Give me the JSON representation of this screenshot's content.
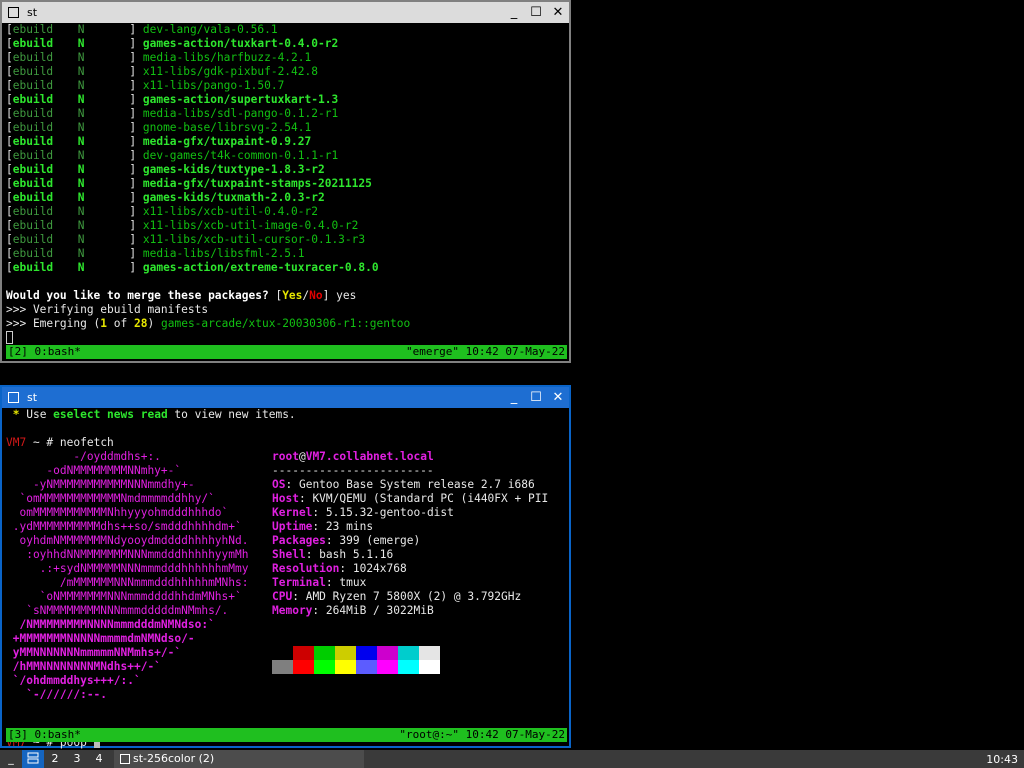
{
  "window1": {
    "title": "st",
    "packages": [
      {
        "tag": "ebuild",
        "flag": "N",
        "name": "dev-lang/vala-0.56.1",
        "bold": false
      },
      {
        "tag": "ebuild",
        "flag": "N",
        "name": "games-action/tuxkart-0.4.0-r2",
        "bold": true
      },
      {
        "tag": "ebuild",
        "flag": "N",
        "name": "media-libs/harfbuzz-4.2.1",
        "bold": false
      },
      {
        "tag": "ebuild",
        "flag": "N",
        "name": "x11-libs/gdk-pixbuf-2.42.8",
        "bold": false
      },
      {
        "tag": "ebuild",
        "flag": "N",
        "name": "x11-libs/pango-1.50.7",
        "bold": false
      },
      {
        "tag": "ebuild",
        "flag": "N",
        "name": "games-action/supertuxkart-1.3",
        "bold": true
      },
      {
        "tag": "ebuild",
        "flag": "N",
        "name": "media-libs/sdl-pango-0.1.2-r1",
        "bold": false
      },
      {
        "tag": "ebuild",
        "flag": "N",
        "name": "gnome-base/librsvg-2.54.1",
        "bold": false
      },
      {
        "tag": "ebuild",
        "flag": "N",
        "name": "media-gfx/tuxpaint-0.9.27",
        "bold": true
      },
      {
        "tag": "ebuild",
        "flag": "N",
        "name": "dev-games/t4k-common-0.1.1-r1",
        "bold": false
      },
      {
        "tag": "ebuild",
        "flag": "N",
        "name": "games-kids/tuxtype-1.8.3-r2",
        "bold": true
      },
      {
        "tag": "ebuild",
        "flag": "N",
        "name": "media-gfx/tuxpaint-stamps-20211125",
        "bold": true
      },
      {
        "tag": "ebuild",
        "flag": "N",
        "name": "games-kids/tuxmath-2.0.3-r2",
        "bold": true
      },
      {
        "tag": "ebuild",
        "flag": "N",
        "name": "x11-libs/xcb-util-0.4.0-r2",
        "bold": false
      },
      {
        "tag": "ebuild",
        "flag": "N",
        "name": "x11-libs/xcb-util-image-0.4.0-r2",
        "bold": false
      },
      {
        "tag": "ebuild",
        "flag": "N",
        "name": "x11-libs/xcb-util-cursor-0.1.3-r3",
        "bold": false
      },
      {
        "tag": "ebuild",
        "flag": "N",
        "name": "media-libs/libsfml-2.5.1",
        "bold": false
      },
      {
        "tag": "ebuild",
        "flag": "N",
        "name": "games-action/extreme-tuxracer-0.8.0",
        "bold": true
      }
    ],
    "merge_question": "Would you like to merge these packages?",
    "yes": "Yes",
    "no": "No",
    "answer": "yes",
    "verifying": ">>> Verifying ebuild manifests",
    "emerging_prefix": ">>> Emerging (",
    "emerging_n": "1",
    "emerging_of": "of",
    "emerging_total": "28",
    "emerging_pkg": "games-arcade/xtux-20030306-r1::gentoo",
    "status_left": "[2] 0:bash*",
    "status_right": "\"emerge\" 10:42 07-May-22"
  },
  "window2": {
    "title": "st",
    "news_pre": " * Use ",
    "news_cmd": "eselect news read",
    "news_post": " to view new items.",
    "prompt_host": "VM7",
    "prompt_sep": " ~ # ",
    "cmd1": "neofetch",
    "cmd2": "poop",
    "logo": [
      "          -/oyddmdhs+:.",
      "      -odNMMMMMMMMNNmhy+-`",
      "    -yNMMMMMMMMMMMNNNmmdhy+-",
      "  `omMMMMMMMMMMMMNmdmmmmddhhy/`",
      "  omMMMMMMMMMMMNhhyyyohmdddhhhdo`",
      " .ydMMMMMMMMMMdhs++so/smdddhhhhdm+`",
      "  oyhdmNMMMMMMMNdyooydmddddhhhhyhNd.",
      "   :oyhhdNNMMMMMMMNNNmmdddhhhhhyymMh",
      "     .:+sydNMMMMMNNNmmmdddhhhhhhmMmy",
      "        /mMMMMMMNNNmmmdddhhhhhmMNhs:",
      "     `oNMMMMMMMNNNmmmddddhhdmMNhs+`",
      "   `sNMMMMMMMMNNNmmmdddddmNMmhs/.",
      "  /NMMMMMMMMNNNNmmmdddmNMNdso:`",
      " +MMMMMMMNNNNNmmmmdmNMNdso/-",
      " yMMNNNNNNNmmmmmNNMmhs+/-`",
      " /hMMNNNNNNNNMNdhs++/-`",
      " `/ohdmmddhys+++/:.`",
      "   `-//////:--."
    ],
    "user": "root",
    "host": "VM7.collabnet.local",
    "separator": "------------------------",
    "info": [
      {
        "key": "OS",
        "value": "Gentoo Base System release 2.7 i686"
      },
      {
        "key": "Host",
        "value": "KVM/QEMU (Standard PC (i440FX + PII"
      },
      {
        "key": "Kernel",
        "value": "5.15.32-gentoo-dist"
      },
      {
        "key": "Uptime",
        "value": "23 mins"
      },
      {
        "key": "Packages",
        "value": "399 (emerge)"
      },
      {
        "key": "Shell",
        "value": "bash 5.1.16"
      },
      {
        "key": "Resolution",
        "value": "1024x768"
      },
      {
        "key": "Terminal",
        "value": "tmux"
      },
      {
        "key": "CPU",
        "value": "AMD Ryzen 7 5800X (2) @ 3.792GHz"
      },
      {
        "key": "Memory",
        "value": "264MiB / 3022MiB"
      }
    ],
    "palette_top": [
      "#000000",
      "#cd0000",
      "#00cd00",
      "#cdcd00",
      "#0000ee",
      "#cd00cd",
      "#00cdcd",
      "#e5e5e5"
    ],
    "palette_bottom": [
      "#7f7f7f",
      "#ff0000",
      "#00ff00",
      "#ffff00",
      "#5c5cff",
      "#ff00ff",
      "#00ffff",
      "#ffffff"
    ],
    "status_left": "[3] 0:bash*",
    "status_right": "\"root@:~\" 10:42 07-May-22"
  },
  "taskbar": {
    "workspaces": [
      "2",
      "3",
      "4"
    ],
    "task_label": "st-256color (2)",
    "clock": "10:43",
    "active_color": "#1565c0"
  }
}
